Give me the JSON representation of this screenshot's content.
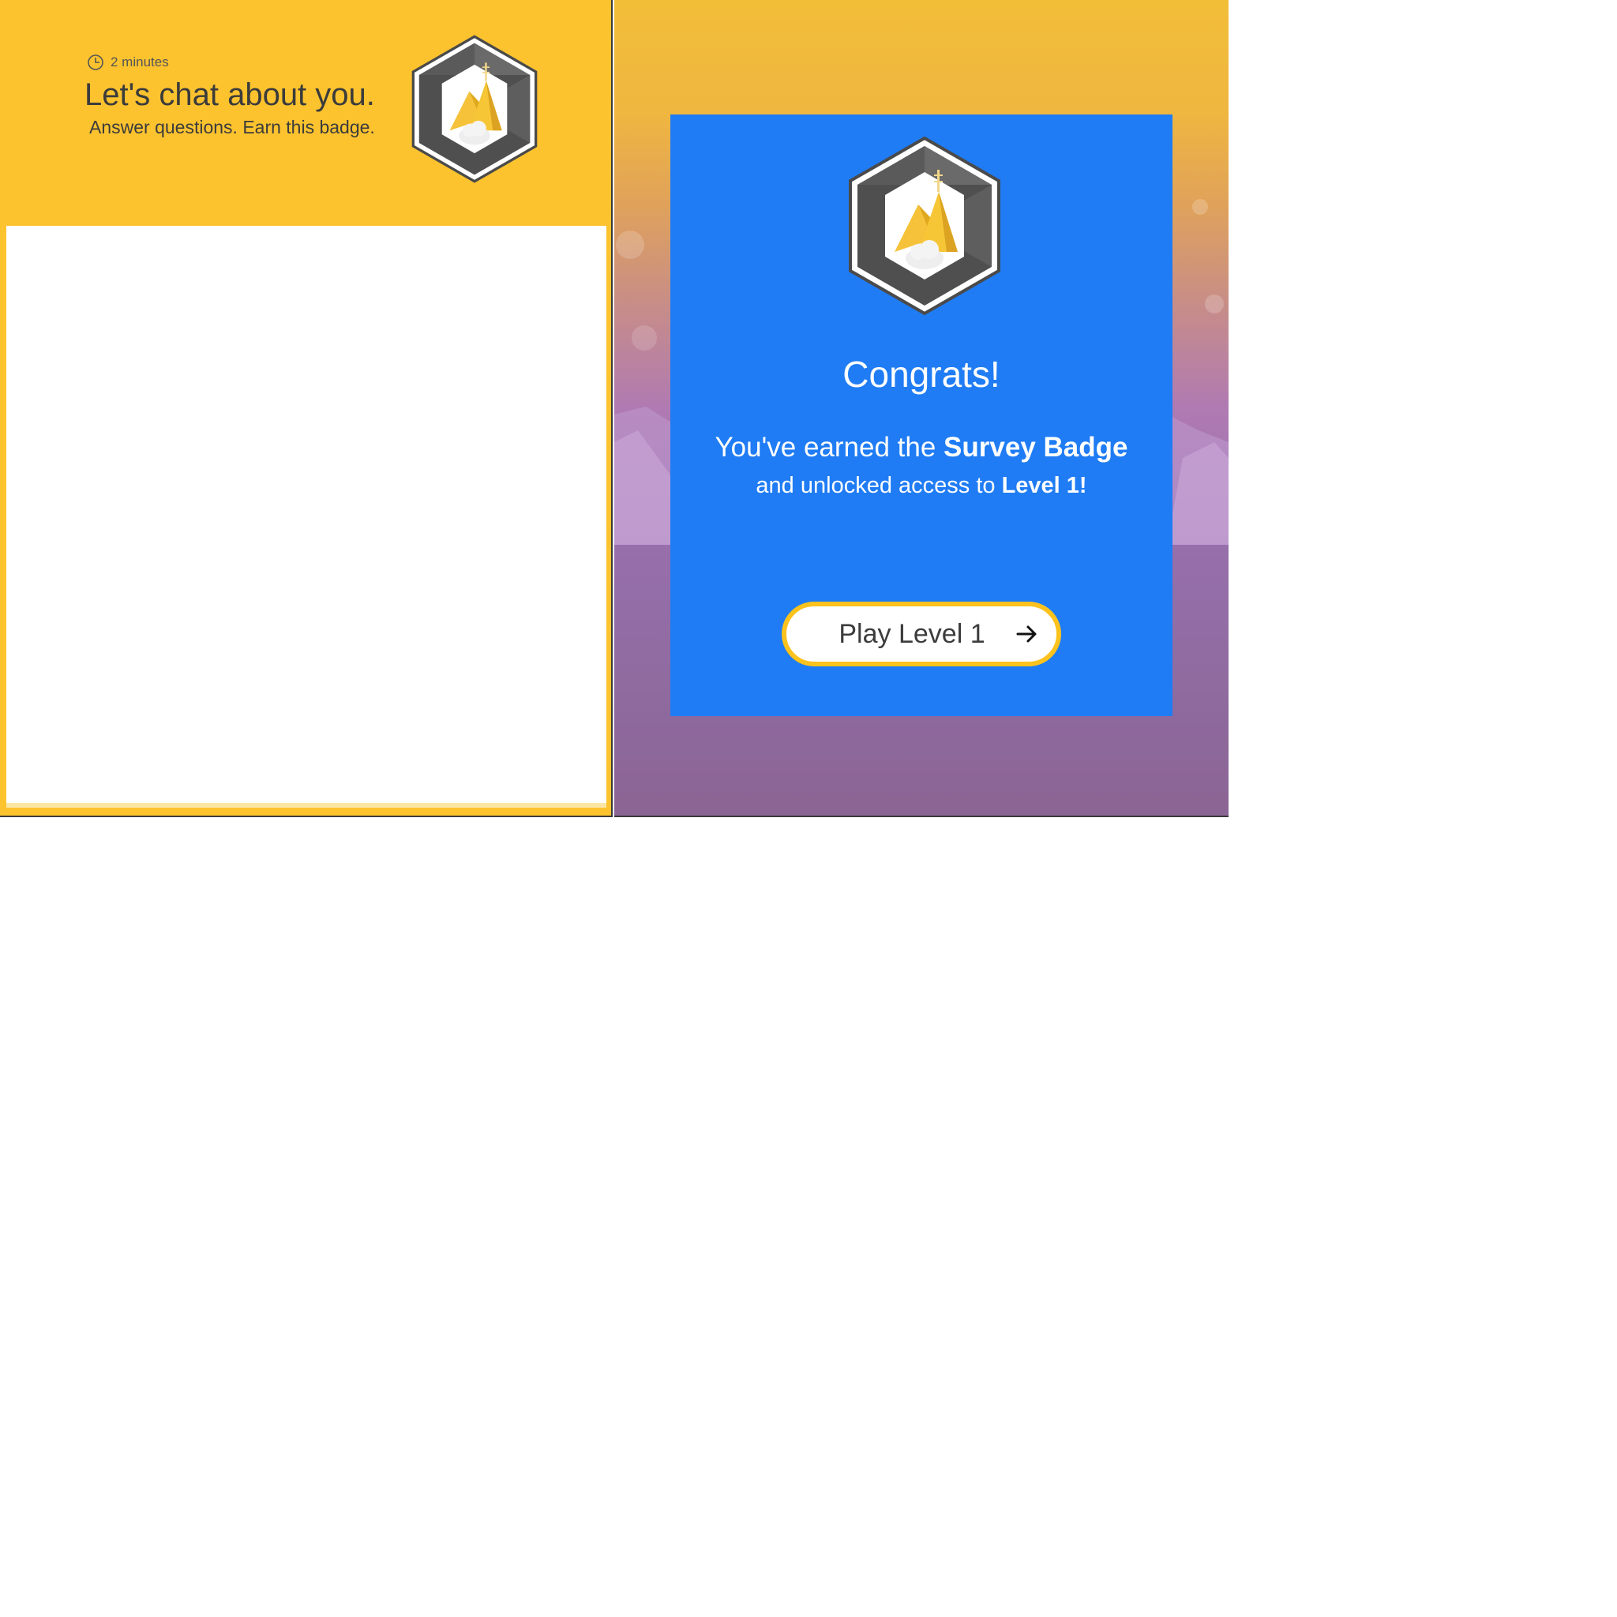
{
  "survey_intro": {
    "duration": "2 minutes",
    "clock_icon": "clock-icon",
    "title": "Let's chat about you.",
    "subtitle": "Answer questions. Earn this badge.",
    "badge_icon": "mountain-badge-icon",
    "background_color": "#fcc32f"
  },
  "congrats_modal": {
    "title": "Congrats!",
    "earned_prefix": "You've earned the ",
    "badge_name": "Survey Badge",
    "unlocked_prefix": "and unlocked access to ",
    "level_name": "Level 1!",
    "badge_icon": "mountain-badge-icon",
    "card_color": "#1f7cf4",
    "button": {
      "label": "Play Level 1",
      "icon": "arrow-right-icon",
      "border_color": "#fcc21d"
    }
  }
}
